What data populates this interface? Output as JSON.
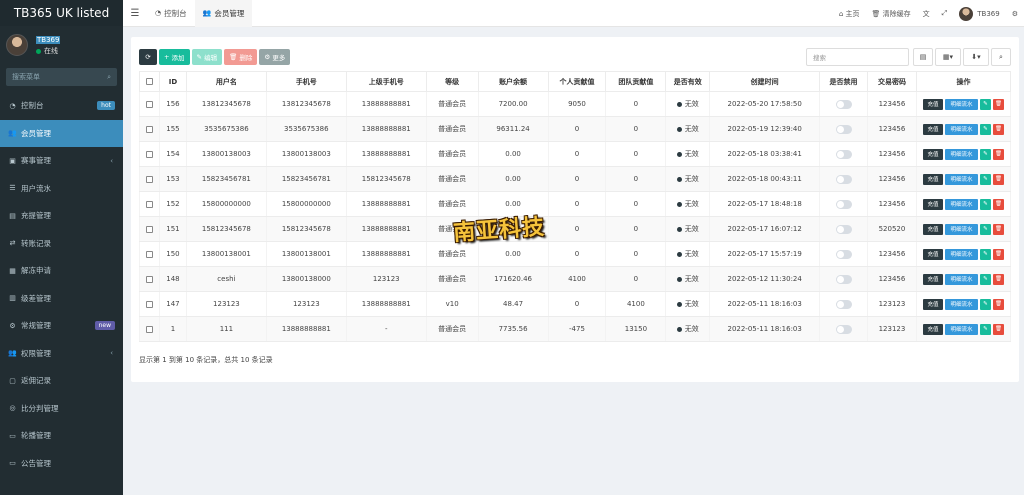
{
  "app": {
    "brand": "TB365 UK listed",
    "user": {
      "name": "TB369",
      "status": "在线"
    },
    "search_placeholder": "搜索菜单"
  },
  "sidebar": {
    "items": [
      {
        "label": "控制台",
        "icon": "dashboard-icon",
        "glyph": "◔",
        "badge": "hot"
      },
      {
        "label": "会员管理",
        "icon": "users-icon",
        "glyph": "👥",
        "active": true
      },
      {
        "label": "赛事管理",
        "icon": "trophy-icon",
        "glyph": "▣",
        "chevron": "‹"
      },
      {
        "label": "用户流水",
        "icon": "list-icon",
        "glyph": "☰"
      },
      {
        "label": "充提管理",
        "icon": "wallet-icon",
        "glyph": "▤"
      },
      {
        "label": "转账记录",
        "icon": "transfer-icon",
        "glyph": "⇄"
      },
      {
        "label": "解冻申请",
        "icon": "unlock-icon",
        "glyph": "▦"
      },
      {
        "label": "级差管理",
        "icon": "level-icon",
        "glyph": "▥"
      },
      {
        "label": "常规管理",
        "icon": "cog-icon",
        "glyph": "⚙",
        "badge": "new"
      },
      {
        "label": "权限管理",
        "icon": "group-icon",
        "glyph": "👥",
        "chevron": "‹"
      },
      {
        "label": "返佣记录",
        "icon": "rebate-icon",
        "glyph": "▢"
      },
      {
        "label": "比分判管理",
        "icon": "score-icon",
        "glyph": "◎"
      },
      {
        "label": "轮播管理",
        "icon": "carousel-icon",
        "glyph": "▭"
      },
      {
        "label": "公告管理",
        "icon": "notice-icon",
        "glyph": "▭"
      }
    ]
  },
  "header": {
    "tabs": [
      {
        "label": "控制台",
        "icon": "dashboard-icon",
        "glyph": "◔"
      },
      {
        "label": "会员管理",
        "icon": "users-icon",
        "glyph": "👥",
        "active": true
      }
    ],
    "home": "主页",
    "clear_cache": "清除缓存",
    "username": "TB369"
  },
  "toolbar": {
    "add": "添加",
    "edit": "编辑",
    "delete": "删除",
    "more": "更多",
    "search_placeholder": "搜索"
  },
  "table": {
    "columns": [
      "ID",
      "用户名",
      "手机号",
      "上级手机号",
      "等级",
      "账户余额",
      "个人贡献值",
      "团队贡献值",
      "是否有效",
      "创建时间",
      "是否禁用",
      "交易密码",
      "操作"
    ],
    "rows": [
      [
        "156",
        "13812345678",
        "13812345678",
        "13888888881",
        "普通会员",
        "7200.00",
        "9050",
        "0",
        "无效",
        "2022-05-20 17:58:50",
        "123456"
      ],
      [
        "155",
        "3535675386",
        "3535675386",
        "13888888881",
        "普通会员",
        "96311.24",
        "0",
        "0",
        "无效",
        "2022-05-19 12:39:40",
        "123456"
      ],
      [
        "154",
        "13800138003",
        "13800138003",
        "13888888881",
        "普通会员",
        "0.00",
        "0",
        "0",
        "无效",
        "2022-05-18 03:38:41",
        "123456"
      ],
      [
        "153",
        "15823456781",
        "15823456781",
        "15812345678",
        "普通会员",
        "0.00",
        "0",
        "0",
        "无效",
        "2022-05-18 00:43:11",
        "123456"
      ],
      [
        "152",
        "15800000000",
        "15800000000",
        "13888888881",
        "普通会员",
        "0.00",
        "0",
        "0",
        "无效",
        "2022-05-17 18:48:18",
        "123456"
      ],
      [
        "151",
        "15812345678",
        "15812345678",
        "13888888881",
        "普通会员",
        "0.00",
        "0",
        "0",
        "无效",
        "2022-05-17 16:07:12",
        "520520"
      ],
      [
        "150",
        "13800138001",
        "13800138001",
        "13888888881",
        "普通会员",
        "0.00",
        "0",
        "0",
        "无效",
        "2022-05-17 15:57:19",
        "123456"
      ],
      [
        "148",
        "ceshi",
        "13800138000",
        "123123",
        "普通会员",
        "171620.46",
        "4100",
        "0",
        "无效",
        "2022-05-12 11:30:24",
        "123456"
      ],
      [
        "147",
        "123123",
        "123123",
        "13888888881",
        "v10",
        "48.47",
        "0",
        "4100",
        "无效",
        "2022-05-11 18:16:03",
        "123123"
      ],
      [
        "1",
        "111",
        "13888888881",
        "-",
        "普通会员",
        "7735.56",
        "-475",
        "13150",
        "无效",
        "2022-05-11 18:16:03",
        "123123"
      ]
    ],
    "actions": {
      "charge": "充值",
      "flow": "明细流水"
    }
  },
  "pagination": {
    "summary": "显示第 1 到第 10 条记录，总共 10 条记录"
  },
  "watermark": "南亚科技",
  "colors": {
    "sidebar_bg": "#222d32",
    "accent": "#3c8dbc",
    "add": "#18bc9c",
    "danger": "#e74c3c",
    "info": "#3498db"
  }
}
